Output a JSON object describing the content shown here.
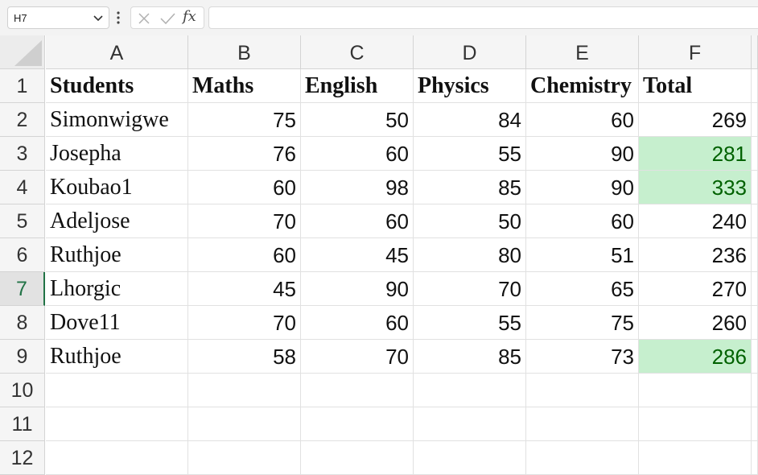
{
  "name_box": {
    "value": "H7",
    "dropdown_icon": "chevron-down-icon"
  },
  "formula_bar": {
    "menu_icon": "more-vertical-icon",
    "cancel_icon": "x-icon",
    "enter_icon": "check-icon",
    "insert_function_label": "fx",
    "value": ""
  },
  "columns": [
    "A",
    "B",
    "C",
    "D",
    "E",
    "F"
  ],
  "rows": [
    "1",
    "2",
    "3",
    "4",
    "5",
    "6",
    "7",
    "8",
    "9",
    "10",
    "11",
    "12"
  ],
  "active_row": "7",
  "table": {
    "headers": [
      "Students",
      "Maths",
      "English",
      "Physics",
      "Chemistry",
      "Total"
    ],
    "records": [
      [
        "Simonwigwe",
        "75",
        "50",
        "84",
        "60",
        "269"
      ],
      [
        "Josepha",
        "76",
        "60",
        "55",
        "90",
        "281"
      ],
      [
        "Koubao1",
        "60",
        "98",
        "85",
        "90",
        "333"
      ],
      [
        "Adeljose",
        "70",
        "60",
        "50",
        "60",
        "240"
      ],
      [
        "Ruthjoe",
        "60",
        "45",
        "80",
        "51",
        "236"
      ],
      [
        "Lhorgic",
        "45",
        "90",
        "70",
        "65",
        "270"
      ],
      [
        "Dove11",
        "70",
        "60",
        "55",
        "75",
        "260"
      ],
      [
        "Ruthjoe",
        "58",
        "70",
        "85",
        "73",
        "286"
      ]
    ],
    "highlighted_totals": [
      "281",
      "333",
      "286"
    ]
  },
  "colors": {
    "highlight_fill": "#c6efce",
    "highlight_text": "#006100",
    "active_header_accent": "#217346"
  }
}
